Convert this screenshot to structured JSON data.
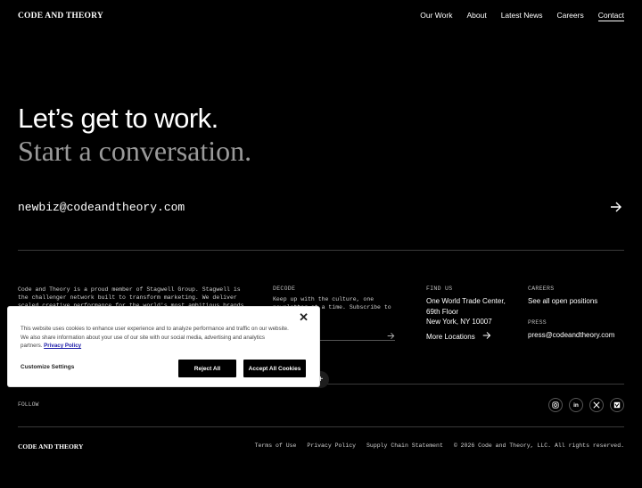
{
  "nav": {
    "logo": "CODE AND THEORY",
    "links": [
      "Our Work",
      "About",
      "Latest News",
      "Careers",
      "Contact"
    ]
  },
  "hero": {
    "headline": "Let’s get to work.",
    "subheadline": "Start a conversation."
  },
  "contact": {
    "email": "newbiz@codeandtheory.com"
  },
  "footer": {
    "about_text_line1": "Code and Theory is a proud member of Stagwell Group. Stagwell is",
    "about_text_line2": "the challenger network built to transform marketing. We deliver",
    "about_text_line3": "scaled creative performance for the world's most ambitious brands.",
    "decode_label": "DECODE",
    "decode_text_line1": "Keep up with the culture, one",
    "decode_text_line2": "newsletter at a time. Subscribe to",
    "find_us_label": "FIND US",
    "address_line1": "One World Trade Center,",
    "address_line2": "69th Floor",
    "address_line3": "New York, NY 10007",
    "more_locations": "More Locations",
    "careers_label": "CAREERS",
    "careers_link": "See all open positions",
    "press_label": "PRESS",
    "press_email": "press@codeandtheory.com",
    "follow_label": "FOLLOW",
    "socials": [
      "instagram-icon",
      "linkedin-icon",
      "x-icon",
      "vimeo-icon"
    ],
    "logo": "CODE AND THEORY",
    "legal_links": [
      "Terms of Use",
      "Privacy Policy",
      "Supply Chain Statement"
    ],
    "copyright": "© 2026 Code and Theory, LLC. All rights reserved."
  },
  "cookie_banner": {
    "text_line1": "This website uses cookies to enhance user experience and to analyze performance and traffic on our website.",
    "text_line2": "We also share information about your use of our site with our social media, advertising and analytics",
    "text_line3": "partners.",
    "privacy_link": "Privacy Policy",
    "close": "✕",
    "customize": "Customize Settings",
    "reject": "Reject All",
    "accept": "Accept All Cookies"
  },
  "plus_symbol": "+"
}
